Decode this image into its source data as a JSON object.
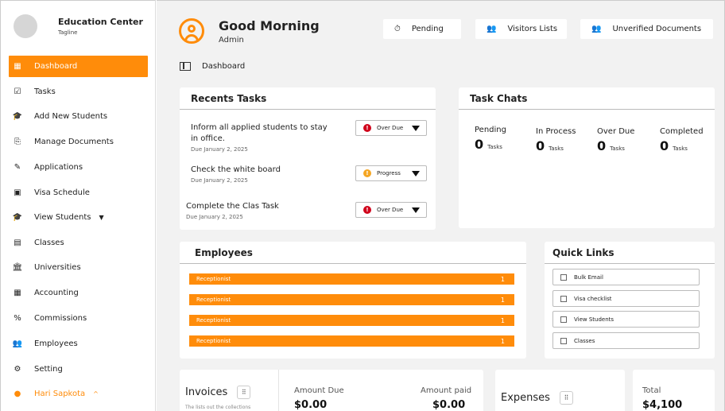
{
  "brand": {
    "name": "Education Center",
    "tagline": "Tagline"
  },
  "sidebar": {
    "items": [
      {
        "label": "Dashboard",
        "icon": "dashboard-icon",
        "glyph": "▦",
        "active": true
      },
      {
        "label": "Tasks",
        "icon": "tasks-icon",
        "glyph": "☑"
      },
      {
        "label": "Add New Students",
        "icon": "graduation-cap-icon",
        "glyph": "🎓"
      },
      {
        "label": "Manage Documents",
        "icon": "documents-icon",
        "glyph": "⎘"
      },
      {
        "label": "Applications",
        "icon": "applications-icon",
        "glyph": "✎"
      },
      {
        "label": "Visa Schedule",
        "icon": "calendar-icon",
        "glyph": "▣"
      },
      {
        "label": "View Students",
        "icon": "students-icon",
        "glyph": "🎓",
        "caret": "▼"
      },
      {
        "label": "Classes",
        "icon": "classes-icon",
        "glyph": "▤"
      },
      {
        "label": "Universities",
        "icon": "university-icon",
        "glyph": "🏛"
      },
      {
        "label": "Accounting",
        "icon": "calculator-icon",
        "glyph": "▦"
      },
      {
        "label": "Commissions",
        "icon": "percent-icon",
        "glyph": "%"
      },
      {
        "label": "Employees",
        "icon": "employees-icon",
        "glyph": "👥"
      },
      {
        "label": "Setting",
        "icon": "gear-icon",
        "glyph": "⚙"
      },
      {
        "label": "Hari Sapkota",
        "icon": "user-icon",
        "glyph": "●",
        "caret": "^",
        "user": true
      }
    ]
  },
  "header": {
    "greeting": "Good Morning",
    "role": "Admin",
    "buttons": [
      {
        "label": "Pending",
        "icon": "stopwatch-icon",
        "glyph": "⏱"
      },
      {
        "label": "Visitors Lists",
        "icon": "visitors-icon",
        "glyph": "👥"
      },
      {
        "label": "Unverified Documents",
        "icon": "unverified-icon",
        "glyph": "👥"
      }
    ],
    "breadcrumb": "Dashboard"
  },
  "recent_tasks": {
    "title": "Recents Tasks",
    "items": [
      {
        "title": "Inform all applied students to stay",
        "title2": " in office.",
        "due": "Due January 2, 2025",
        "status": "Over Due",
        "status_color": "#d0021b"
      },
      {
        "title": "Check the white board",
        "title2": "",
        "due": "Due January 2, 2025",
        "status": "Progress",
        "status_color": "#f5a623"
      },
      {
        "title": "Complete the Clas Task",
        "title2": "",
        "due": "Due January 2, 2025",
        "status": "Over Due",
        "status_color": "#d0021b"
      }
    ]
  },
  "task_chats": {
    "title": "Task Chats",
    "stats": [
      {
        "label": "Pending",
        "value": "0",
        "unit": "Tasks"
      },
      {
        "label": "In Process",
        "value": "0",
        "unit": "Tasks"
      },
      {
        "label": "Over Due",
        "value": "0",
        "unit": "Tasks"
      },
      {
        "label": "Completed",
        "value": "0",
        "unit": "Tasks"
      }
    ]
  },
  "employees": {
    "title": "Employees",
    "rows": [
      {
        "role": "Receptionist",
        "count": "1"
      },
      {
        "role": "Receptionist",
        "count": "1"
      },
      {
        "role": "Receptionist",
        "count": "1"
      },
      {
        "role": "Receptionist",
        "count": "1"
      }
    ]
  },
  "quick_links": {
    "title": "Quick Links",
    "items": [
      "Bulk Email",
      "Visa checklist",
      "View Students",
      "Classes"
    ]
  },
  "invoices": {
    "title": "Invoices",
    "subtitle": "The lists out the collections",
    "menu_icon": "⠿",
    "amount_due_label": "Amount Due",
    "amount_due": "$0.00",
    "amount_paid_label": "Amount paid",
    "amount_paid": "$0.00"
  },
  "expenses": {
    "title": "Expenses",
    "menu_icon": "⠿"
  },
  "total": {
    "label": "Total",
    "value": "$4,100"
  },
  "colors": {
    "accent": "#ff8c0a",
    "background": "#f2f2f2"
  }
}
